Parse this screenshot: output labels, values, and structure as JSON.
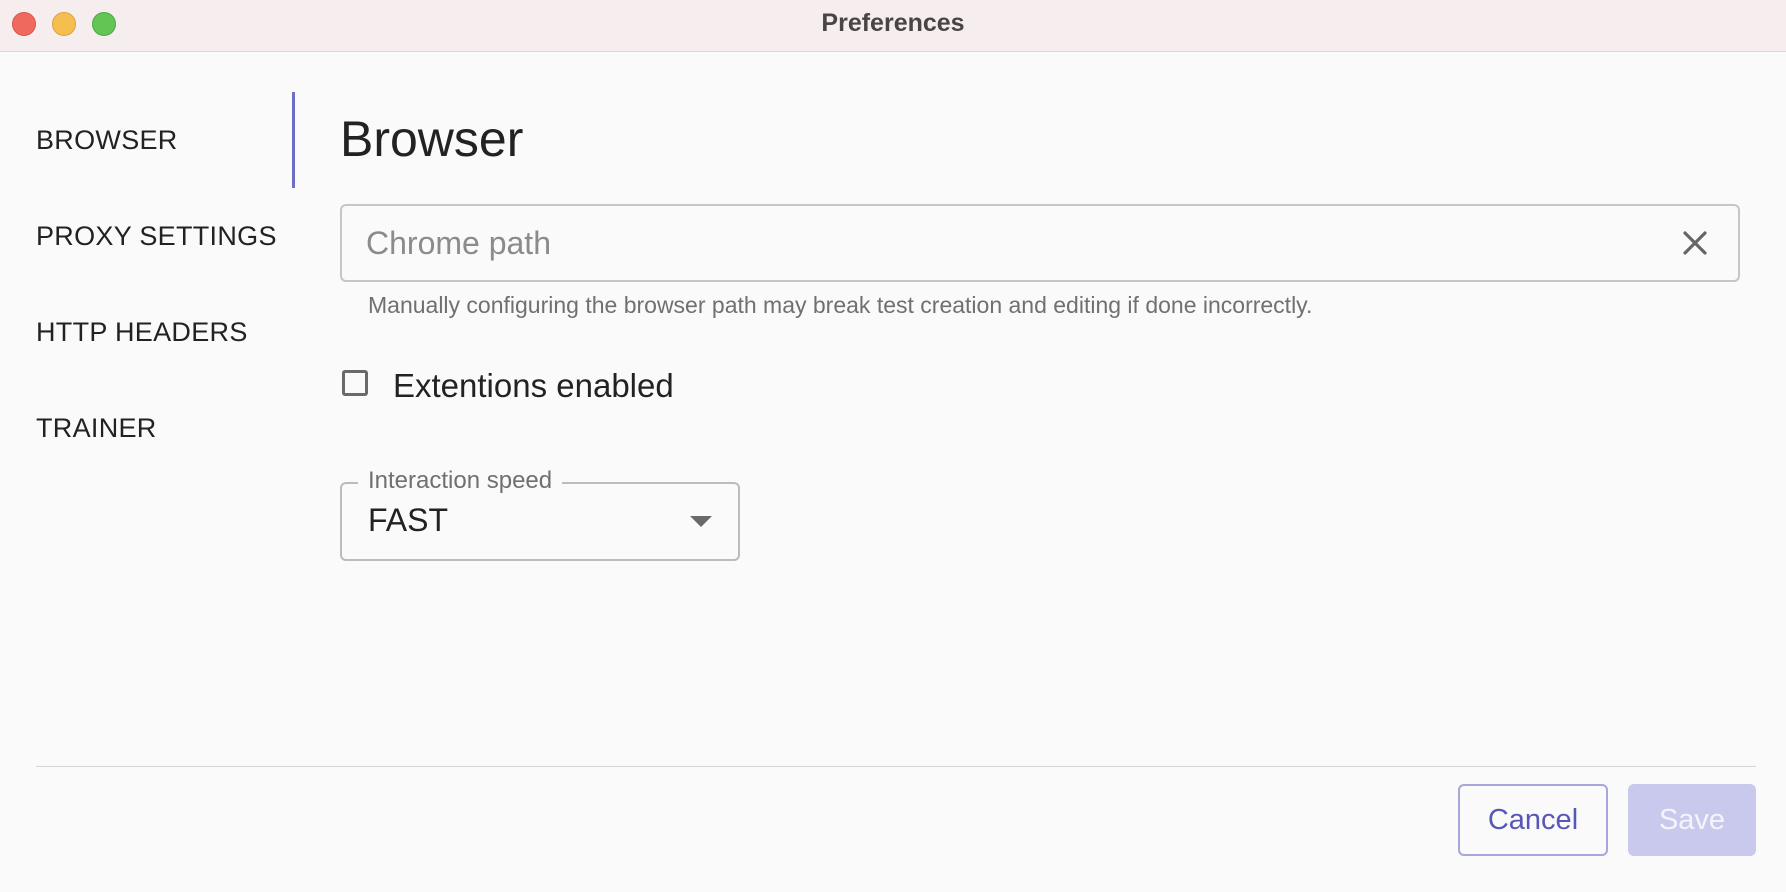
{
  "window": {
    "title": "Preferences"
  },
  "sidebar": {
    "items": [
      {
        "label": "BROWSER",
        "active": true
      },
      {
        "label": "PROXY SETTINGS",
        "active": false
      },
      {
        "label": "HTTP HEADERS",
        "active": false
      },
      {
        "label": "TRAINER",
        "active": false
      }
    ]
  },
  "main": {
    "title": "Browser",
    "chrome_path": {
      "value": "",
      "placeholder": "Chrome path",
      "helper": "Manually configuring the browser path may break test creation and editing if done incorrectly.",
      "clear_icon": "close-icon"
    },
    "extensions": {
      "label": "Extentions enabled",
      "checked": false
    },
    "interaction_speed": {
      "label": "Interaction speed",
      "value": "FAST",
      "caret_icon": "caret-down-icon"
    }
  },
  "footer": {
    "cancel_label": "Cancel",
    "save_label": "Save",
    "save_disabled": true
  },
  "colors": {
    "accent": "#6e6ec4",
    "title_bar": "#f6eeee",
    "save_disabled_bg": "#c9c9ee",
    "traffic_close": "#ee6a5f",
    "traffic_minimize": "#f5be4f",
    "traffic_maximize": "#62c554"
  }
}
